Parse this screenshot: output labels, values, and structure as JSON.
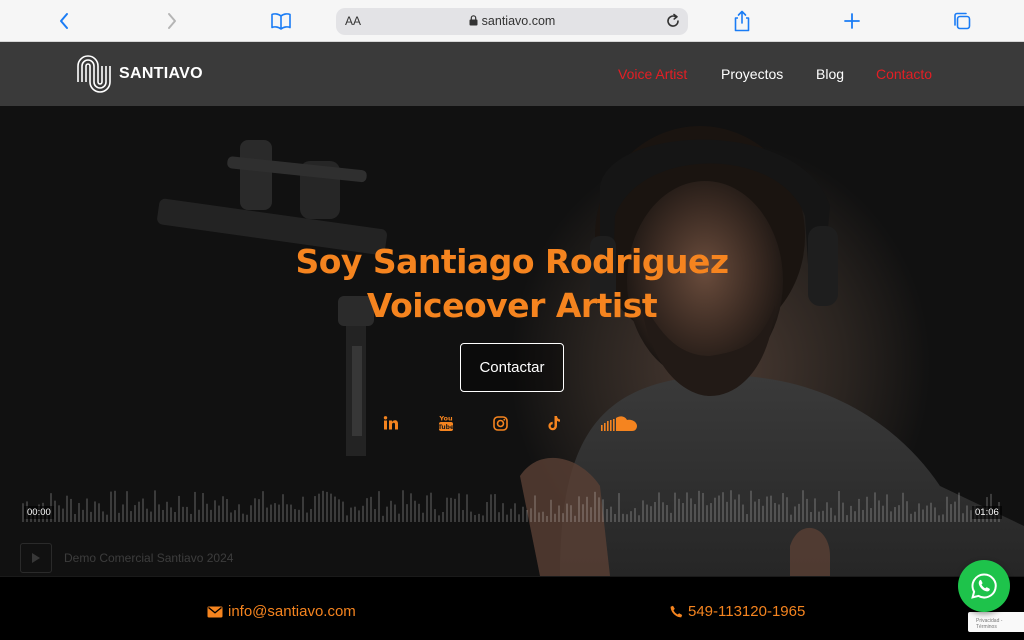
{
  "browser": {
    "aa_label": "AA",
    "url": "santiavo.com"
  },
  "site": {
    "logo_text": "SANTIAVO",
    "nav": [
      {
        "label": "Voice Artist",
        "active": true
      },
      {
        "label": "Proyectos",
        "active": false
      },
      {
        "label": "Blog",
        "active": false
      },
      {
        "label": "Contacto",
        "active": true
      }
    ]
  },
  "hero": {
    "headline_line1": "Soy Santiago Rodriguez",
    "headline_line2": "Voiceover Artist",
    "cta_label": "Contactar",
    "social_icons": [
      "linkedin-icon",
      "youtube-icon",
      "instagram-icon",
      "tiktok-icon",
      "soundcloud-icon"
    ]
  },
  "player": {
    "current_time": "00:00",
    "duration": "01:06",
    "track_title": "Demo Comercial Santiavo 2024"
  },
  "contact": {
    "email": "info@santiavo.com",
    "phone": "549-113120-1965"
  },
  "recaptcha_text": "Privacidad - Términos",
  "colors": {
    "accent_orange": "#f5841f",
    "nav_red": "#e31e24",
    "whatsapp_green": "#1ec34b",
    "safari_blue": "#1a7cf5"
  }
}
